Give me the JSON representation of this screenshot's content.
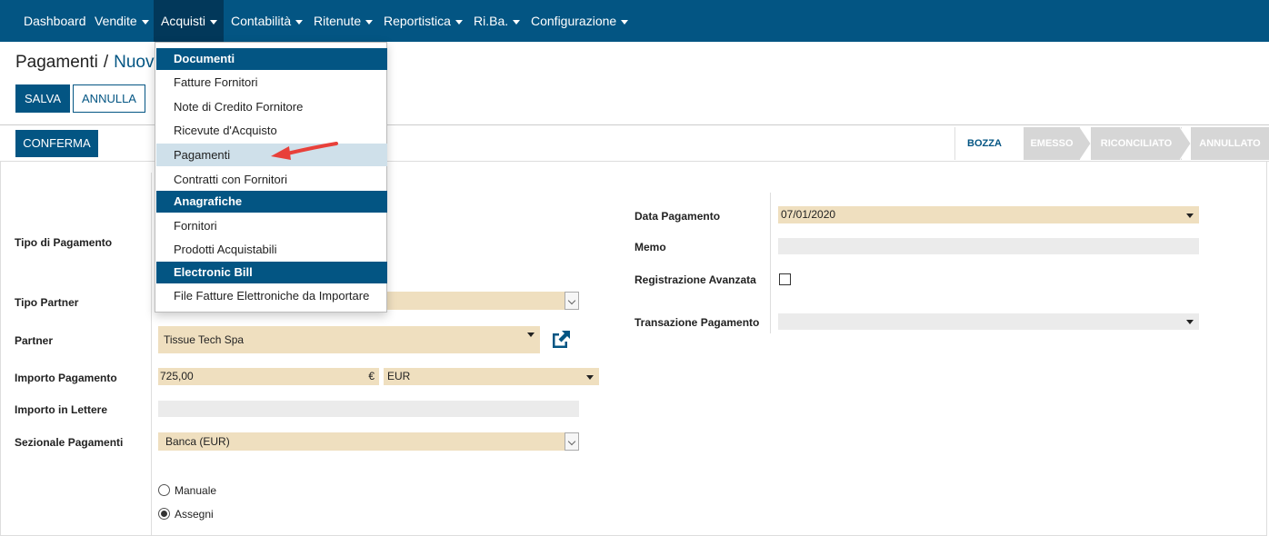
{
  "nav": {
    "items": [
      {
        "label": "Dashboard"
      },
      {
        "label": "Vendite"
      },
      {
        "label": "Acquisti"
      },
      {
        "label": "Contabilità"
      },
      {
        "label": "Ritenute"
      },
      {
        "label": "Reportistica"
      },
      {
        "label": "Ri.Ba."
      },
      {
        "label": "Configurazione"
      }
    ]
  },
  "breadcrumb": {
    "parent": "Pagamenti",
    "sep": "/",
    "current": "Nuovo"
  },
  "toolbar": {
    "save": "SALVA",
    "discard": "ANNULLA",
    "confirm": "CONFERMA"
  },
  "statusbar": {
    "steps": [
      "BOZZA",
      "EMESSO",
      "RICONCILIATO",
      "ANNULLATO"
    ],
    "active": "BOZZA"
  },
  "menu": {
    "sections": [
      {
        "title": "Documenti",
        "items": [
          "Fatture Fornitori",
          "Note di Credito Fornitore",
          "Ricevute d'Acquisto",
          "Pagamenti",
          "Contratti con Fornitori"
        ]
      },
      {
        "title": "Anagrafiche",
        "items": [
          "Fornitori",
          "Prodotti Acquistabili"
        ]
      },
      {
        "title": "Electronic Bill",
        "items": [
          "File Fatture Elettroniche da Importare"
        ]
      }
    ],
    "highlighted": "Pagamenti"
  },
  "form": {
    "left": {
      "tipo_pagamento": {
        "label": "Tipo di Pagamento"
      },
      "tipo_partner": {
        "label": "Tipo Partner"
      },
      "partner": {
        "label": "Partner",
        "value": "Tissue Tech Spa"
      },
      "importo": {
        "label": "Importo Pagamento",
        "value": "725,00",
        "currency_symbol": "€",
        "currency": "EUR"
      },
      "importo_lettere": {
        "label": "Importo in Lettere",
        "value": ""
      },
      "sezionale": {
        "label": "Sezionale Pagamenti",
        "value": "Banca (EUR)"
      },
      "metodo": {
        "options": [
          "Manuale",
          "Assegni"
        ],
        "selected": "Assegni"
      }
    },
    "right": {
      "data": {
        "label": "Data Pagamento",
        "value": "07/01/2020"
      },
      "memo": {
        "label": "Memo",
        "value": ""
      },
      "registrazione": {
        "label": "Registrazione Avanzata",
        "checked": false
      },
      "transazione": {
        "label": "Transazione Pagamento",
        "value": ""
      }
    }
  },
  "colors": {
    "primary": "#035583",
    "required_bg": "#efdfbf",
    "menu_highlight": "#cfe0ea",
    "arrow": "#e8403a"
  }
}
